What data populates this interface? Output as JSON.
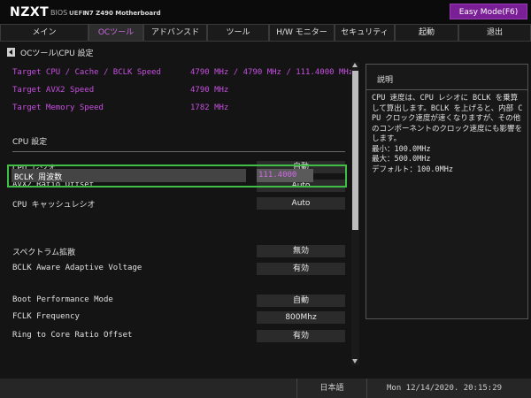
{
  "header": {
    "brand": "NZXT",
    "bios": "BIOS",
    "uefi": "UEFI",
    "board": "N7 Z490 Motherboard",
    "easy_mode": "Easy Mode(F6)"
  },
  "tabs": [
    {
      "label": "メイン"
    },
    {
      "label": "OCツール",
      "active": true
    },
    {
      "label": "アドバンスド"
    },
    {
      "label": "ツール"
    },
    {
      "label": "H/W モニター"
    },
    {
      "label": "セキュリティ"
    },
    {
      "label": "起動"
    },
    {
      "label": "退出"
    }
  ],
  "breadcrumb": "OCツール\\CPU 設定",
  "info": [
    {
      "label": "Target CPU / Cache / BCLK Speed",
      "value": "4790 MHz / 4790 MHz / 111.4000 MHz"
    },
    {
      "label": "Target AVX2 Speed",
      "value": "4790 MHz"
    },
    {
      "label": "Target Memory Speed",
      "value": "1782 MHz"
    }
  ],
  "section_title": "CPU 設定",
  "settings_top": [
    {
      "label": "CPU  レシオ",
      "value": "自動"
    },
    {
      "label": "AVX2 Ratio Offset",
      "value": "Auto"
    },
    {
      "label": "CPU  キャッシュレシオ",
      "value": "Auto"
    }
  ],
  "bclk": {
    "label": "BCLK 周波数",
    "value": "111.4000"
  },
  "settings_mid": [
    {
      "label": "スペクトラム拡散",
      "value": "無効"
    },
    {
      "label": "BCLK Aware Adaptive Voltage",
      "value": "有効"
    }
  ],
  "settings_bottom": [
    {
      "label": "Boot Performance Mode",
      "value": "自動"
    },
    {
      "label": "FCLK Frequency",
      "value": "800Mhz"
    },
    {
      "label": "Ring to Core Ratio Offset",
      "value": "有効"
    }
  ],
  "description": {
    "title": "説明",
    "text": "CPU 速度は、CPU レシオに BCLK を乗算して算出します。BCLK を上げると、内部 CPU クロック速度が速くなりますが、その他のコンポーネントのクロック速度にも影響をします。\n最小：100.0MHz\n最大：500.0MHz\nデフォルト：100.0MHz"
  },
  "footer": {
    "language": "日本語",
    "datetime": "Mon 12/14/2020. 20:15:29"
  },
  "colors": {
    "accent": "#c64fe0",
    "easy_mode_bg": "#7a1f95",
    "highlight": "#3fbf45"
  }
}
